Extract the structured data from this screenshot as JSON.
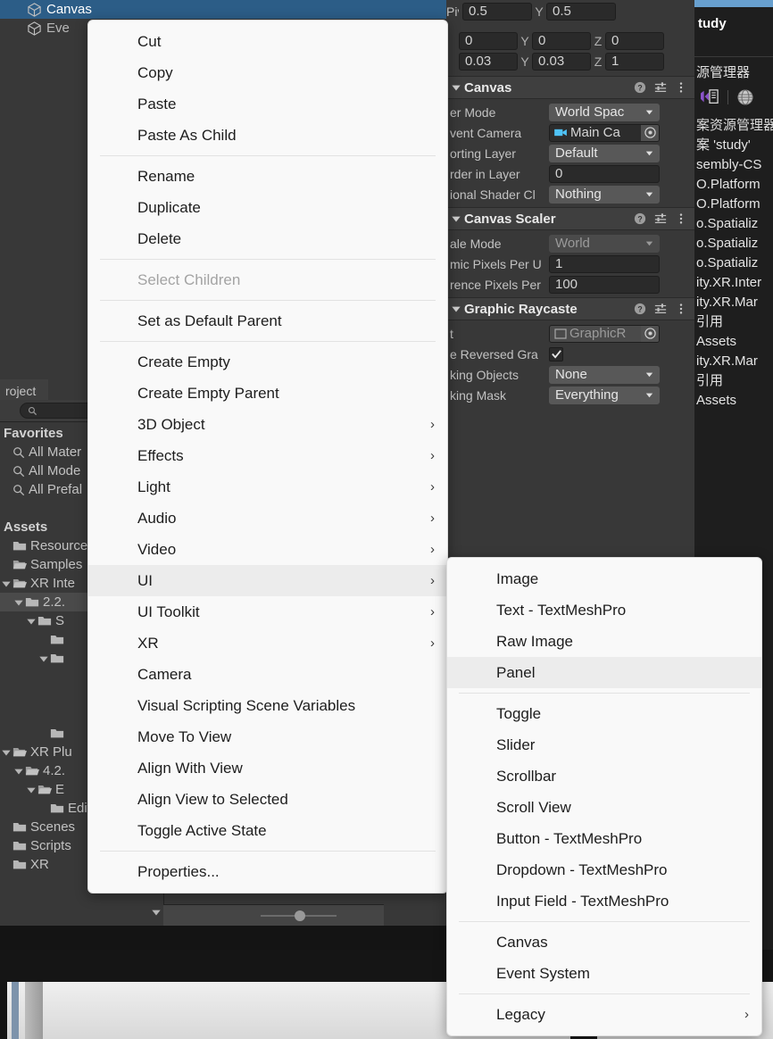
{
  "hierarchy": {
    "rows": [
      {
        "label": "Canvas",
        "icon": "cube-icon",
        "selected": true
      },
      {
        "label": "Eve",
        "icon": "cube-icon",
        "selected": false
      }
    ]
  },
  "project": {
    "tab_label": "roject",
    "search_placeholder": "",
    "search_icon": "search-icon",
    "tree": [
      {
        "label": "Favorites",
        "kind": "header",
        "indent": 0
      },
      {
        "label": "All Mater",
        "kind": "search",
        "indent": 0
      },
      {
        "label": "All Mode",
        "kind": "search",
        "indent": 0
      },
      {
        "label": "All Prefal",
        "kind": "search",
        "indent": 0
      },
      {
        "label": "",
        "kind": "spacer",
        "indent": 0
      },
      {
        "label": "Assets",
        "kind": "header",
        "indent": 0
      },
      {
        "label": "Resource",
        "kind": "folder",
        "indent": 0
      },
      {
        "label": "Samples",
        "kind": "folder-open",
        "indent": 0
      },
      {
        "label": "XR Inte",
        "kind": "folder-open",
        "indent": 0,
        "twisty": "down"
      },
      {
        "label": "2.2.",
        "kind": "folder",
        "indent": 1,
        "twisty": "down",
        "selected": true
      },
      {
        "label": "S",
        "kind": "folder",
        "indent": 2,
        "twisty": "down"
      },
      {
        "label": "",
        "kind": "folder",
        "indent": 3
      },
      {
        "label": "",
        "kind": "folder",
        "indent": 3,
        "twisty": "down"
      },
      {
        "label": "",
        "kind": "spacer",
        "indent": 0
      },
      {
        "label": "",
        "kind": "spacer",
        "indent": 0
      },
      {
        "label": "",
        "kind": "spacer",
        "indent": 0
      },
      {
        "label": "",
        "kind": "folder",
        "indent": 3
      },
      {
        "label": "XR Plu",
        "kind": "folder-open",
        "indent": 0,
        "twisty": "down"
      },
      {
        "label": "4.2.",
        "kind": "folder-open",
        "indent": 1,
        "twisty": "down"
      },
      {
        "label": "E",
        "kind": "folder-open",
        "indent": 2,
        "twisty": "down"
      },
      {
        "label": "Editor",
        "kind": "folder",
        "indent": 3
      },
      {
        "label": "Scenes",
        "kind": "folder",
        "indent": 0
      },
      {
        "label": "Scripts",
        "kind": "folder",
        "indent": 0
      },
      {
        "label": "XR",
        "kind": "folder",
        "indent": 0
      }
    ],
    "zoom_slider_value": 45
  },
  "inspector": {
    "pivot": {
      "label": "Piv X",
      "x_value": "0.5",
      "y_axis_label": "Y",
      "y_value": "0.5"
    },
    "rotation": {
      "x_value": "0",
      "y_axis_label": "Y",
      "y_value": "0",
      "z_axis_label": "Z",
      "z_value": "0"
    },
    "scale": {
      "x_value": "0.03",
      "y_axis_label": "Y",
      "y_value": "0.03",
      "z_axis_label": "Z",
      "z_value": "1"
    },
    "components": [
      {
        "name": "Canvas",
        "icons": [
          "help-icon",
          "preset-icon",
          "more-menu-icon"
        ],
        "fields": [
          {
            "label": "er Mode",
            "type": "dropdown",
            "value": "World Spac"
          },
          {
            "label": "vent Camera",
            "type": "objectfield",
            "value": "Main Ca",
            "icon": "camera-icon"
          },
          {
            "label": "orting Layer",
            "type": "dropdown",
            "value": "Default"
          },
          {
            "label": "rder in Layer",
            "type": "number",
            "value": "0"
          },
          {
            "label": "ional Shader Cl",
            "type": "dropdown",
            "value": "Nothing"
          }
        ]
      },
      {
        "name": "Canvas Scaler",
        "icons": [
          "help-icon",
          "preset-icon",
          "more-menu-icon"
        ],
        "fields": [
          {
            "label": "ale Mode",
            "type": "dropdown-disabled",
            "value": "World"
          },
          {
            "label": "mic Pixels Per U",
            "type": "number",
            "value": "1"
          },
          {
            "label": "rence Pixels Per",
            "type": "number",
            "value": "100"
          }
        ]
      },
      {
        "name": "Graphic Raycaste",
        "icons": [
          "help-icon",
          "preset-icon",
          "more-menu-icon"
        ],
        "fields": [
          {
            "label": "t",
            "type": "objectfield-disabled",
            "value": "GraphicR",
            "icon": "script-icon"
          },
          {
            "label": "e Reversed Gra",
            "type": "checkbox",
            "value": "checked"
          },
          {
            "label": "king Objects",
            "type": "dropdown",
            "value": "None"
          },
          {
            "label": "king Mask",
            "type": "dropdown",
            "value": "Everything"
          }
        ]
      }
    ]
  },
  "visual_studio": {
    "tab_label": "tudy",
    "section_title": "源管理器",
    "toolbar_icons": [
      "visual-studio-icon",
      "globe-icon"
    ],
    "filter_label": "案资源管理器",
    "nodes": [
      "案 'study'",
      "sembly-CS",
      "O.Platform",
      "O.Platform",
      "o.Spatializ",
      "o.Spatializ",
      "o.Spatializ",
      "ity.XR.Inter",
      "ity.XR.Mar",
      "引用",
      "Assets",
      "ity.XR.Mar",
      "引用",
      "Assets"
    ]
  },
  "context_menu": {
    "name": "hierarchy-context-menu",
    "items": [
      {
        "label": "Cut",
        "type": "item"
      },
      {
        "label": "Copy",
        "type": "item"
      },
      {
        "label": "Paste",
        "type": "item"
      },
      {
        "label": "Paste As Child",
        "type": "item"
      },
      {
        "label": "",
        "type": "separator"
      },
      {
        "label": "Rename",
        "type": "item"
      },
      {
        "label": "Duplicate",
        "type": "item"
      },
      {
        "label": "Delete",
        "type": "item"
      },
      {
        "label": "",
        "type": "separator"
      },
      {
        "label": "Select Children",
        "type": "item",
        "disabled": true
      },
      {
        "label": "",
        "type": "separator"
      },
      {
        "label": "Set as Default Parent",
        "type": "item"
      },
      {
        "label": "",
        "type": "separator"
      },
      {
        "label": "Create Empty",
        "type": "item"
      },
      {
        "label": "Create Empty Parent",
        "type": "item"
      },
      {
        "label": "3D Object",
        "type": "item",
        "submenu": true
      },
      {
        "label": "Effects",
        "type": "item",
        "submenu": true
      },
      {
        "label": "Light",
        "type": "item",
        "submenu": true
      },
      {
        "label": "Audio",
        "type": "item",
        "submenu": true
      },
      {
        "label": "Video",
        "type": "item",
        "submenu": true
      },
      {
        "label": "UI",
        "type": "item",
        "submenu": true,
        "highlight": true
      },
      {
        "label": "UI Toolkit",
        "type": "item",
        "submenu": true
      },
      {
        "label": "XR",
        "type": "item",
        "submenu": true
      },
      {
        "label": "Camera",
        "type": "item"
      },
      {
        "label": "Visual Scripting Scene Variables",
        "type": "item"
      },
      {
        "label": "Move To View",
        "type": "item"
      },
      {
        "label": "Align With View",
        "type": "item"
      },
      {
        "label": "Align View to Selected",
        "type": "item"
      },
      {
        "label": "Toggle Active State",
        "type": "item"
      },
      {
        "label": "",
        "type": "separator"
      },
      {
        "label": "Properties...",
        "type": "item"
      }
    ]
  },
  "ui_submenu": {
    "name": "ui-submenu",
    "items": [
      {
        "label": "Image",
        "type": "item"
      },
      {
        "label": "Text - TextMeshPro",
        "type": "item"
      },
      {
        "label": "Raw Image",
        "type": "item"
      },
      {
        "label": "Panel",
        "type": "item",
        "highlight": true
      },
      {
        "label": "",
        "type": "separator"
      },
      {
        "label": "Toggle",
        "type": "item"
      },
      {
        "label": "Slider",
        "type": "item"
      },
      {
        "label": "Scrollbar",
        "type": "item"
      },
      {
        "label": "Scroll View",
        "type": "item"
      },
      {
        "label": "Button - TextMeshPro",
        "type": "item"
      },
      {
        "label": "Dropdown - TextMeshPro",
        "type": "item"
      },
      {
        "label": "Input Field - TextMeshPro",
        "type": "item"
      },
      {
        "label": "",
        "type": "separator"
      },
      {
        "label": "Canvas",
        "type": "item"
      },
      {
        "label": "Event System",
        "type": "item"
      },
      {
        "label": "",
        "type": "separator"
      },
      {
        "label": "Legacy",
        "type": "item",
        "submenu": true
      }
    ]
  },
  "colors": {
    "selection_blue": "#2c5d87",
    "panel_bg": "#383838",
    "menu_bg": "#f9f9f9",
    "menu_highlight": "#ececec",
    "vs_accent": "#68a0cf"
  }
}
